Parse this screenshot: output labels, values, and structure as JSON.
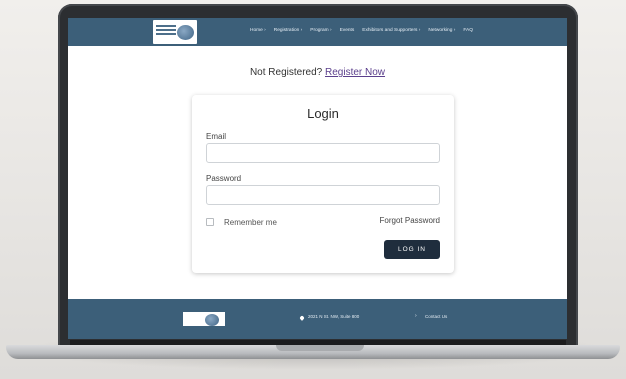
{
  "header": {
    "nav": [
      {
        "label": "Home ›"
      },
      {
        "label": "Registration ›"
      },
      {
        "label": "Program ›"
      },
      {
        "label": "Events"
      },
      {
        "label": "Exhibitors and Supporters ›"
      },
      {
        "label": "Networking ›"
      },
      {
        "label": "FAQ"
      }
    ]
  },
  "banner": {
    "prompt": "Not Registered?",
    "link": "Register Now"
  },
  "login": {
    "title": "Login",
    "email_label": "Email",
    "email_value": "",
    "password_label": "Password",
    "password_value": "",
    "remember_label": "Remember me",
    "forgot_label": "Forgot Password",
    "button_label": "LOG IN"
  },
  "footer": {
    "address": "2021 N St. NW, Suite 800",
    "contact": "Contact Us"
  },
  "colors": {
    "header_bg": "#3c5f79",
    "button_bg": "#1f2d3d",
    "link": "#5b3f8c"
  },
  "icons": [
    "logo",
    "pin-icon",
    "chevron-right-icon"
  ]
}
